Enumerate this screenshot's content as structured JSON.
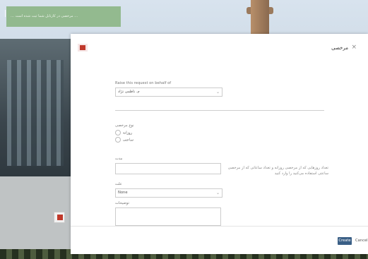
{
  "ticker": {
    "text": "… مرخصی در کارتابل شما ثبت شده است …"
  },
  "modal": {
    "title": "مرخصی",
    "close_label": "×",
    "raise_on_behalf": {
      "label": "Raise this request on behalf of",
      "value": "م. ناظمی نژاد"
    },
    "leave_type": {
      "label": "نوع مرخصی",
      "options": [
        "روزانه",
        "ساعتی"
      ]
    },
    "duration": {
      "label": "مدت",
      "value": ""
    },
    "duration_help": "تعداد روزهایی که از مرخصی روزانه و تعداد ساعاتی که از مرخصی ساعتی استفاده می‌کنید را وارد کنید",
    "reason": {
      "label": "علت",
      "value": "None"
    },
    "description": {
      "label": "توضیحات",
      "value": ""
    },
    "footer": {
      "create_label": "Create",
      "cancel_label": "Cancel"
    }
  },
  "colors": {
    "primary_button": "#3a5f86",
    "ticker_bg": "#8fb78a",
    "logo_red": "#c0392b"
  }
}
